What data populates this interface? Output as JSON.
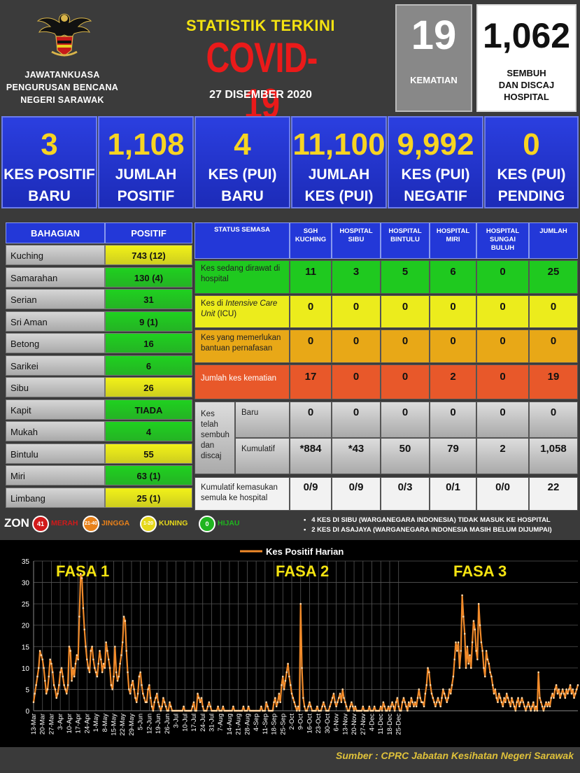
{
  "header": {
    "org_line1": "JAWATANKUASA",
    "org_line2": "PENGURUSAN BENCANA",
    "org_line3": "NEGERI SARAWAK",
    "title_small": "STATISTIK TERKINI",
    "title_big": "COVID-19",
    "date": "27 DISEMBER 2020",
    "deaths": {
      "value": "19",
      "label": "KEMATIAN"
    },
    "recovered": {
      "value": "1,062",
      "label1": "SEMBUH",
      "label2": "DAN DISCAJ",
      "label3": "HOSPITAL"
    }
  },
  "summary": [
    {
      "value": "3",
      "label1": "KES POSITIF",
      "label2": "BARU"
    },
    {
      "value": "1,108",
      "label1": "JUMLAH",
      "label2": "POSITIF"
    },
    {
      "value": "4",
      "label1": "KES (PUI)",
      "label2": "BARU"
    },
    {
      "value": "11,100",
      "label1": "JUMLAH",
      "label2": "KES (PUI)"
    },
    {
      "value": "9,992",
      "label1": "KES (PUI)",
      "label2": "NEGATIF"
    },
    {
      "value": "0",
      "label1": "KES (PUI)",
      "label2": "PENDING"
    }
  ],
  "divisions": {
    "header_name": "BAHAGIAN",
    "header_value": "POSITIF",
    "rows": [
      {
        "name": "Kuching",
        "value": "743 (12)",
        "color": "#f2f218"
      },
      {
        "name": "Samarahan",
        "value": "130 (4)",
        "color": "#1fd11f"
      },
      {
        "name": "Serian",
        "value": "31",
        "color": "#1fd11f"
      },
      {
        "name": "Sri Aman",
        "value": "9 (1)",
        "color": "#1fd11f"
      },
      {
        "name": "Betong",
        "value": "16",
        "color": "#1fd11f"
      },
      {
        "name": "Sarikei",
        "value": "6",
        "color": "#1fd11f"
      },
      {
        "name": "Sibu",
        "value": "26",
        "color": "#f2f218"
      },
      {
        "name": "Kapit",
        "value": "TIADA",
        "color": "#1fd11f"
      },
      {
        "name": "Mukah",
        "value": "4",
        "color": "#1fd11f"
      },
      {
        "name": "Bintulu",
        "value": "55",
        "color": "#f2f218"
      },
      {
        "name": "Miri",
        "value": "63 (1)",
        "color": "#1fd11f"
      },
      {
        "name": "Limbang",
        "value": "25 (1)",
        "color": "#f2f218"
      }
    ]
  },
  "hospitals": {
    "header_status": "STATUS SEMASA",
    "columns": [
      {
        "line1": "SGH",
        "line2": "KUCHING",
        "line3": ""
      },
      {
        "line1": "HOSPITAL SIBU",
        "line2": "",
        "line3": ""
      },
      {
        "line1": "HOSPITAL",
        "line2": "BINTULU",
        "line3": ""
      },
      {
        "line1": "HOSPITAL",
        "line2": "MIRI",
        "line3": ""
      },
      {
        "line1": "HOSPITAL",
        "line2": "SUNGAI",
        "line3": "BULUH"
      },
      {
        "line1": "JUMLAH",
        "line2": "",
        "line3": ""
      }
    ],
    "rows": [
      {
        "label1": "Kes sedang dirawat di",
        "label2": "hospital",
        "label2b": "",
        "values": [
          "11",
          "3",
          "5",
          "6",
          "0",
          "25"
        ],
        "color": "#1fc91f"
      },
      {
        "label1": "Kes di ",
        "label1i": "Intensive Care",
        "label2": "Unit",
        "label2b": " (ICU)",
        "values": [
          "0",
          "0",
          "0",
          "0",
          "0",
          "0"
        ],
        "color": "#ecec1c"
      },
      {
        "label1": "Kes yang memerlukan",
        "label2": "bantuan pernafasan",
        "label2b": "",
        "values": [
          "0",
          "0",
          "0",
          "0",
          "0",
          "0"
        ],
        "color": "#e8a817"
      },
      {
        "label1": "Jumlah kes kematian",
        "label2": "",
        "label2b": "",
        "values": [
          "17",
          "0",
          "0",
          "2",
          "0",
          "19"
        ],
        "color": "#e8582a"
      }
    ],
    "recovered": {
      "label": [
        "Kes",
        "telah",
        "sembuh",
        "dan",
        "discaj"
      ],
      "baru_label": "Baru",
      "baru": [
        "0",
        "0",
        "0",
        "0",
        "0",
        "0"
      ],
      "kumulatif_label": "Kumulatif",
      "kumulatif": [
        "*884",
        "*43",
        "50",
        "79",
        "2",
        "1,058"
      ]
    },
    "readmit": {
      "label1": "Kumulatif kemasukan",
      "label2": "semula ke hospital",
      "values": [
        "0/9",
        "0/9",
        "0/3",
        "0/1",
        "0/0",
        "22"
      ]
    }
  },
  "legend": {
    "title": "ZON",
    "zones": [
      {
        "num": "41",
        "name": "MERAH",
        "color": "#d11a1a"
      },
      {
        "num": "21-40",
        "name": "JINGGA",
        "color": "#e8811a"
      },
      {
        "num": "1-20",
        "name": "KUNING",
        "color": "#e6d81a"
      },
      {
        "num": "0",
        "name": "HIJAU",
        "color": "#1fb51f"
      }
    ],
    "note1": "4 KES DI SIBU (WARGANEGARA INDONESIA) TIDAK MASUK KE HOSPITAL",
    "note2": "2 KES DI ASAJAYA (WARGANEGARA INDONESIA MASIH BELUM DIJUMPAI)"
  },
  "chart_data": {
    "type": "line",
    "title": "",
    "series": [
      {
        "name": "Kes Positif Harian",
        "color": "#f08a2a",
        "values": [
          2,
          4,
          6,
          8,
          10,
          14,
          13,
          12,
          10,
          7,
          4,
          5,
          8,
          12,
          11,
          9,
          6,
          5,
          3,
          4,
          6,
          9,
          10,
          8,
          6,
          5,
          4,
          6,
          15,
          14,
          7,
          10,
          8,
          11,
          13,
          12,
          22,
          32,
          31,
          24,
          19,
          15,
          12,
          10,
          9,
          14,
          15,
          12,
          10,
          9,
          8,
          11,
          14,
          12,
          9,
          11,
          10,
          16,
          14,
          12,
          10,
          6,
          5,
          8,
          15,
          9,
          7,
          8,
          11,
          13,
          16,
          22,
          21,
          14,
          9,
          5,
          4,
          6,
          7,
          5,
          3,
          2,
          4,
          8,
          9,
          6,
          4,
          3,
          2,
          2,
          5,
          6,
          3,
          1,
          0,
          2,
          3,
          4,
          2,
          1,
          0,
          1,
          3,
          2,
          1,
          0,
          0,
          2,
          1,
          0,
          0,
          0,
          0,
          0,
          0,
          0,
          0,
          0,
          1,
          0,
          0,
          0,
          0,
          0,
          0,
          1,
          2,
          0,
          0,
          4,
          3,
          2,
          3,
          1,
          0,
          0,
          0,
          1,
          2,
          1,
          0,
          0,
          0,
          0,
          0,
          1,
          0,
          0,
          0,
          1,
          0,
          0,
          0,
          0,
          0,
          0,
          0,
          1,
          0,
          0,
          0,
          0,
          0,
          0,
          0,
          1,
          0,
          0,
          0,
          1,
          0,
          0,
          0,
          0,
          0,
          0,
          0,
          0,
          0,
          1,
          0,
          0,
          0,
          2,
          1,
          0,
          0,
          0,
          0,
          2,
          3,
          1,
          2,
          4,
          2,
          6,
          8,
          5,
          7,
          9,
          11,
          8,
          6,
          4,
          3,
          2,
          1,
          0,
          1,
          0,
          25,
          10,
          3,
          1,
          0,
          0,
          1,
          2,
          1,
          0,
          0,
          0,
          0,
          1,
          0,
          0,
          0,
          1,
          2,
          1,
          0,
          0,
          0,
          1,
          2,
          3,
          4,
          2,
          1,
          2,
          3,
          4,
          2,
          5,
          3,
          2,
          1,
          0,
          0,
          1,
          2,
          1,
          0,
          1,
          0,
          0,
          0,
          0,
          0,
          1,
          0,
          0,
          0,
          0,
          1,
          0,
          0,
          0,
          1,
          0,
          0,
          0,
          0,
          1,
          0,
          2,
          1,
          0,
          0,
          1,
          0,
          1,
          2,
          1,
          0,
          2,
          3,
          1,
          0,
          0,
          2,
          3,
          2,
          1,
          0,
          2,
          1,
          3,
          2,
          1,
          2,
          1,
          3,
          5,
          3,
          2,
          2,
          1,
          4,
          6,
          10,
          9,
          6,
          4,
          3,
          2,
          1,
          2,
          3,
          2,
          1,
          3,
          5,
          4,
          3,
          2,
          3,
          5,
          4,
          6,
          8,
          12,
          16,
          14,
          16,
          10,
          14,
          27,
          22,
          18,
          10,
          15,
          11,
          13,
          10,
          16,
          21,
          19,
          14,
          12,
          25,
          20,
          16,
          14,
          10,
          8,
          14,
          12,
          11,
          9,
          8,
          6,
          4,
          5,
          3,
          2,
          4,
          3,
          2,
          1,
          3,
          2,
          4,
          3,
          2,
          1,
          3,
          2,
          1,
          0,
          2,
          3,
          1,
          2,
          3,
          2,
          1,
          0,
          1,
          2,
          1,
          0,
          1,
          2,
          0,
          1,
          0,
          9,
          3,
          2,
          1,
          0,
          1,
          2,
          1,
          2,
          1,
          3,
          4,
          3,
          5,
          6,
          4,
          5,
          3,
          4,
          5,
          4,
          3,
          5,
          4,
          5,
          6,
          4,
          5,
          3,
          4,
          5,
          6
        ]
      }
    ],
    "x_tick_labels": [
      "13-Mar",
      "20-Mar",
      "27-Mar",
      "3-Apr",
      "10-Apr",
      "17-Apr",
      "24-Apr",
      "1-May",
      "8-May",
      "15-May",
      "22-May",
      "29-May",
      "5-Jun",
      "12-Jun",
      "19-Jun",
      "26-Jun",
      "3-Jul",
      "10-Jul",
      "17-Jul",
      "24-Jul",
      "31-Jul",
      "7-Aug",
      "14-Aug",
      "21-Aug",
      "28-Aug",
      "4-Sep",
      "11-Sep",
      "18-Sep",
      "25-Sep",
      "2-Oct",
      "9-Oct",
      "16-Oct",
      "23-Oct",
      "30-Oct",
      "6-Nov",
      "13-Nov",
      "20-Nov",
      "27-Nov",
      "4-Dec",
      "11-Dec",
      "18-Dec",
      "25-Dec"
    ],
    "y_ticks": [
      0,
      5,
      10,
      15,
      20,
      25,
      30,
      35
    ],
    "ylim": [
      0,
      35
    ],
    "grid": true,
    "annotations": [
      "FASA 1",
      "FASA 2",
      "FASA 3"
    ],
    "legend_position": "top"
  },
  "source": "Sumber : CPRC Jabatan Kesihatan Negeri Sarawak"
}
